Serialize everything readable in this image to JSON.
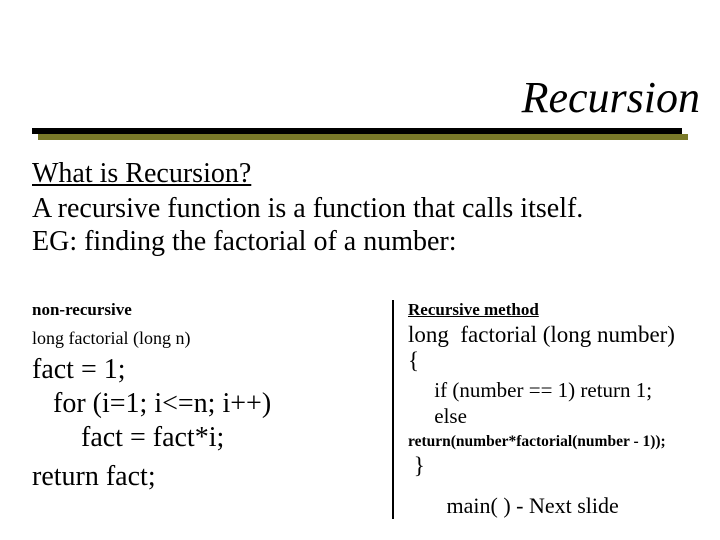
{
  "title": "Recursion",
  "heading": "What is Recursion?",
  "definition": "A recursive function is a function that calls itself.",
  "example_intro": "EG: finding the factorial of a number:",
  "left": {
    "label": "non-recursive",
    "signature": "long  factorial (long n)",
    "code": "fact = 1;\n   for (i=1; i<=n; i++)\n       fact = fact*i;",
    "return": "return fact;"
  },
  "right": {
    "label": "Recursive method",
    "signature": "long  factorial (long number)\n{",
    "body": "     if (number == 1) return 1;\n     else",
    "return_line": "return(number*factorial(number - 1));",
    "close": " }",
    "next": "       main( ) - Next slide"
  }
}
